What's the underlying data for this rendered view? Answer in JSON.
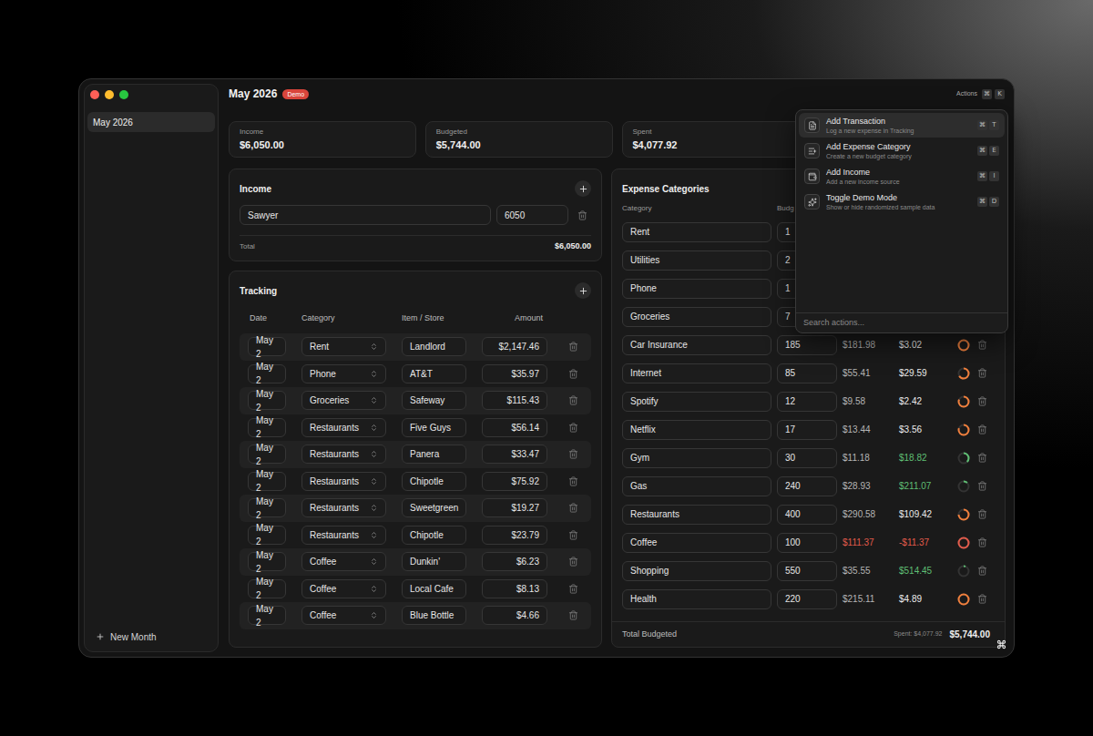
{
  "window": {
    "title": "May 2026",
    "badge": "Demo"
  },
  "sidebar": {
    "items": [
      {
        "label": "May 2026",
        "selected": true
      }
    ],
    "new_button": {
      "label": "New Month"
    }
  },
  "actions_button": {
    "label": "Actions",
    "keys": [
      "⌘",
      "K"
    ]
  },
  "summary": [
    {
      "label": "Income",
      "value": "$6,050.00"
    },
    {
      "label": "Budgeted",
      "value": "$5,744.00"
    },
    {
      "label": "Spent",
      "value": "$4,077.92"
    }
  ],
  "income": {
    "title": "Income",
    "rows": [
      {
        "name": "Sawyer",
        "amount": "6050"
      }
    ],
    "total_label": "Total",
    "total": "$6,050.00"
  },
  "tracking": {
    "title": "Tracking",
    "columns": [
      "Date",
      "Category",
      "Item / Store",
      "Amount"
    ],
    "rows": [
      {
        "date": "May 2",
        "category": "Rent",
        "item": "Landlord",
        "amount": "$2,147.46"
      },
      {
        "date": "May 2",
        "category": "Phone",
        "item": "AT&T",
        "amount": "$35.97"
      },
      {
        "date": "May 2",
        "category": "Groceries",
        "item": "Safeway",
        "amount": "$115.43"
      },
      {
        "date": "May 2",
        "category": "Restaurants",
        "item": "Five Guys",
        "amount": "$56.14"
      },
      {
        "date": "May 2",
        "category": "Restaurants",
        "item": "Panera",
        "amount": "$33.47"
      },
      {
        "date": "May 2",
        "category": "Restaurants",
        "item": "Chipotle",
        "amount": "$75.92"
      },
      {
        "date": "May 2",
        "category": "Restaurants",
        "item": "Sweetgreen",
        "amount": "$19.27"
      },
      {
        "date": "May 2",
        "category": "Restaurants",
        "item": "Chipotle",
        "amount": "$23.79"
      },
      {
        "date": "May 2",
        "category": "Coffee",
        "item": "Dunkin'",
        "amount": "$6.23"
      },
      {
        "date": "May 2",
        "category": "Coffee",
        "item": "Local Cafe",
        "amount": "$8.13"
      },
      {
        "date": "May 2",
        "category": "Coffee",
        "item": "Blue Bottle",
        "amount": "$4.66"
      }
    ]
  },
  "expenses": {
    "title": "Expense Categories",
    "columns": [
      "Category",
      "Budg"
    ],
    "rows": [
      {
        "category": "Rent",
        "budget": "1"
      },
      {
        "category": "Utilities",
        "budget": "2"
      },
      {
        "category": "Phone",
        "budget": "1"
      },
      {
        "category": "Groceries",
        "budget": "7"
      },
      {
        "category": "Car Insurance",
        "budget": "185",
        "spent": "$181.98",
        "remaining": "$3.02",
        "level": 0.98,
        "color": "#f07f3c",
        "status": "ok"
      },
      {
        "category": "Internet",
        "budget": "85",
        "spent": "$55.41",
        "remaining": "$29.59",
        "level": 0.65,
        "color": "#f07f3c",
        "status": "ok"
      },
      {
        "category": "Spotify",
        "budget": "12",
        "spent": "$9.58",
        "remaining": "$2.42",
        "level": 0.8,
        "color": "#f07f3c",
        "status": "ok"
      },
      {
        "category": "Netflix",
        "budget": "17",
        "spent": "$13.44",
        "remaining": "$3.56",
        "level": 0.79,
        "color": "#f07f3c",
        "status": "ok"
      },
      {
        "category": "Gym",
        "budget": "30",
        "spent": "$11.18",
        "remaining": "$18.82",
        "level": 0.37,
        "color": "#5fbf74",
        "status": "under"
      },
      {
        "category": "Gas",
        "budget": "240",
        "spent": "$28.93",
        "remaining": "$211.07",
        "level": 0.12,
        "color": "#5fbf74",
        "status": "under"
      },
      {
        "category": "Restaurants",
        "budget": "400",
        "spent": "$290.58",
        "remaining": "$109.42",
        "level": 0.73,
        "color": "#f07f3c",
        "status": "ok"
      },
      {
        "category": "Coffee",
        "budget": "100",
        "spent": "$111.37",
        "remaining": "-$11.37",
        "level": 1,
        "color": "#e25b4b",
        "status": "over"
      },
      {
        "category": "Shopping",
        "budget": "550",
        "spent": "$35.55",
        "remaining": "$514.45",
        "level": 0.06,
        "color": "#5fbf74",
        "status": "under"
      },
      {
        "category": "Health",
        "budget": "220",
        "spent": "$215.11",
        "remaining": "$4.89",
        "level": 0.98,
        "color": "#f07f3c",
        "status": "ok"
      }
    ],
    "footer": {
      "label": "Total Budgeted",
      "spent": "Spent: $4,077.92",
      "total": "$5,744.00"
    }
  },
  "command_palette": {
    "items": [
      {
        "title": "Add Transaction",
        "subtitle": "Log a new expense in Tracking",
        "keys": [
          "⌘",
          "T"
        ],
        "selected": true
      },
      {
        "title": "Add Expense Category",
        "subtitle": "Create a new budget category",
        "keys": [
          "⌘",
          "E"
        ],
        "selected": false
      },
      {
        "title": "Add Income",
        "subtitle": "Add a new income source",
        "keys": [
          "⌘",
          "I"
        ],
        "selected": false
      },
      {
        "title": "Toggle Demo Mode",
        "subtitle": "Show or hide randomized sample data",
        "keys": [
          "⌘",
          "D"
        ],
        "selected": false
      }
    ],
    "search": {
      "placeholder": "Search actions..."
    }
  }
}
